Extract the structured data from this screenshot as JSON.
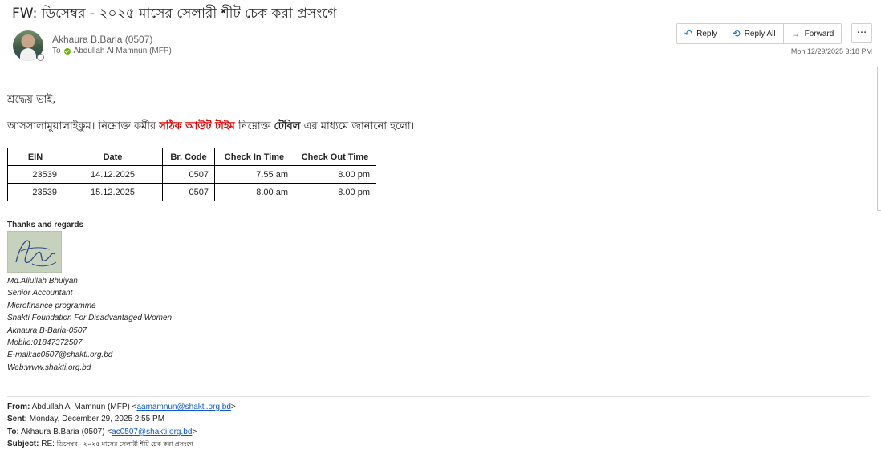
{
  "email": {
    "subject": "FW: ডিসেম্বর - ২০২৫ মাসের সেলারী শীট চেক করা প্রসংগে",
    "sender": "Akhaura B.Baria (0507)",
    "to_prefix": "To",
    "recipient": "Abdullah Al Mamnun (MFP)",
    "timestamp": "Mon 12/29/2025 3:18 PM"
  },
  "actions": {
    "reply": "Reply",
    "reply_all": "Reply All",
    "forward": "Forward",
    "more": "···"
  },
  "body": {
    "greeting": "শ্রদ্ধেয় ভাই,",
    "line_part1": "আসসালামুয়ালাইকুম। নিম্নোক্ত কর্মীর ",
    "line_red": "সঠিক আউট টাইম",
    "line_part2": " নিম্নোক্ত ",
    "line_bold": "টেবিল",
    "line_part3": " এর মাধ্যমে জানানো হলো।"
  },
  "table": {
    "headers": [
      "EIN",
      "Date",
      "Br. Code",
      "Check In Time",
      "Check Out Time"
    ],
    "rows": [
      [
        "23539",
        "14.12.2025",
        "0507",
        "7.55 am",
        "8.00 pm"
      ],
      [
        "23539",
        "15.12.2025",
        "0507",
        "8.00 am",
        "8.00 pm"
      ]
    ]
  },
  "signature": {
    "thanks": "Thanks and regards",
    "lines": [
      "Md.Aliullah Bhuiyan",
      "Senior Accountant",
      "Microfinance programme",
      "Shakti Foundation For Disadvantaged Women",
      "Akhaura B-Baria-0507",
      "Mobile:01847372507",
      "E-mail:ac0507@shakti.org.bd",
      "Web:www.shakti.org.bd"
    ]
  },
  "forwarded": {
    "from_label": "From:",
    "from_name": "Abdullah Al Mamnun (MFP) <",
    "from_email": "aamamnun@shakti.org.bd",
    "from_close": ">",
    "sent_label": "Sent:",
    "sent_value": "Monday, December 29, 2025 2:55 PM",
    "to_label": "To:",
    "to_name": "Akhaura B.Baria (0507) <",
    "to_email": "ac0507@shakti.org.bd",
    "to_close": ">",
    "subject_label": "Subject:",
    "subject_prefix": "RE:",
    "subject_value": "ডিসেম্বর - ২০২৫ মাসের সেলারী শীট চেক করা প্রসংগে"
  },
  "colors": {
    "accent": "#0f6cbd",
    "presence": "#6bb700",
    "highlight_red": "#e00000"
  },
  "icons": {
    "reply": "reply-arrow-icon",
    "reply_all": "reply-all-arrow-icon",
    "forward": "forward-arrow-icon",
    "presence": "available-check-icon"
  }
}
